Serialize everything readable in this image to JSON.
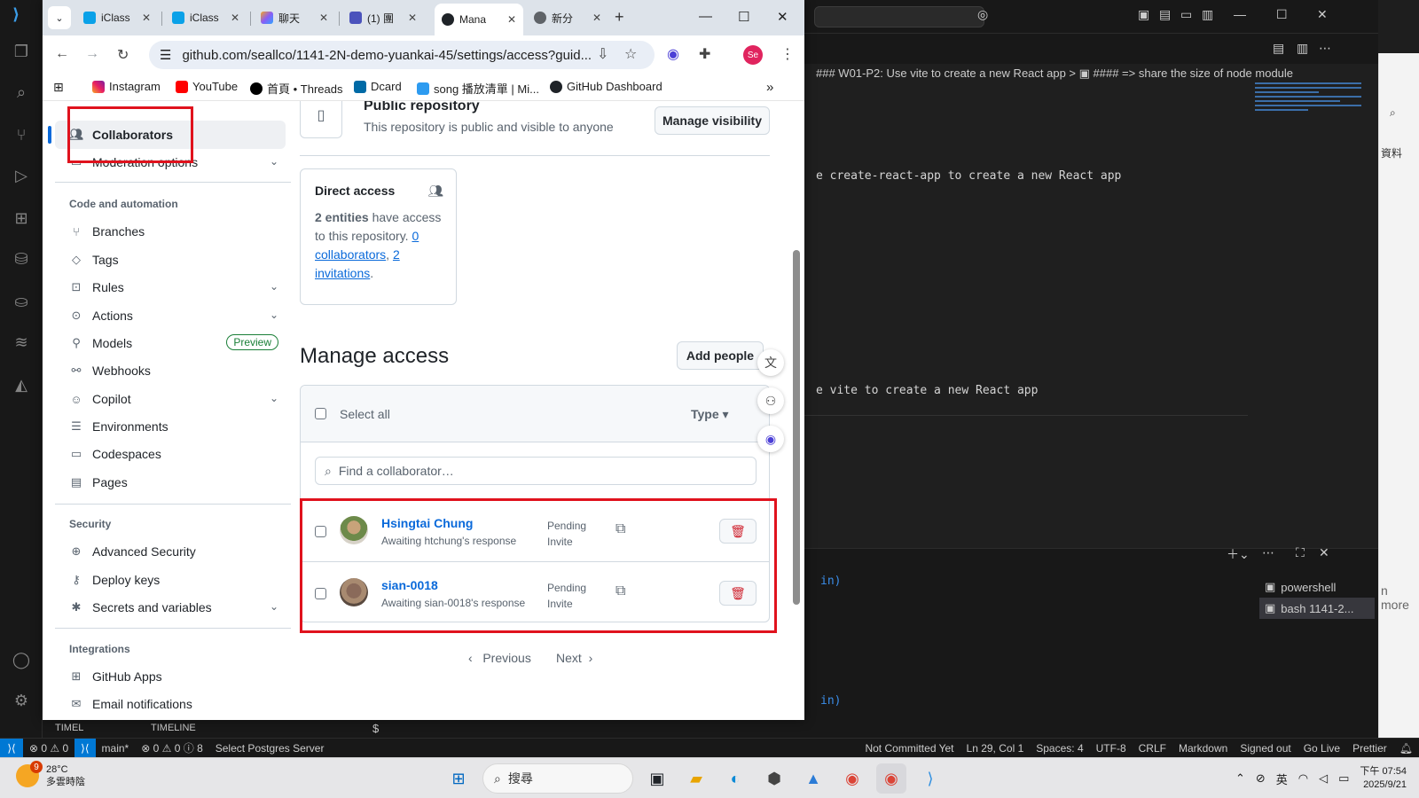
{
  "chrome": {
    "tabs": [
      {
        "label": "iClass",
        "favicon_color": "#0aa1e8"
      },
      {
        "label": "iClass",
        "favicon_color": "#0aa1e8"
      },
      {
        "label": "聊天",
        "favicon_color": "#8a5cf6"
      },
      {
        "label": "(1) 團",
        "favicon_color": "#4b53bc"
      },
      {
        "label": "Mana",
        "favicon_color": "#1f2328"
      },
      {
        "label": "新分",
        "favicon_color": "#5f6368"
      }
    ],
    "url": "github.com/seallco/1141-2N-demo-yuankai-45/settings/access?guid...",
    "profile_initials": "Se",
    "bookmarks": [
      "Instagram",
      "YouTube",
      "首頁 • Threads",
      "Dcard",
      "song 播放清單 | Mi...",
      "GitHub Dashboard"
    ]
  },
  "sidebar": {
    "items_access": [
      {
        "label": "Collaborators",
        "icon": "people-icon",
        "selected": true
      },
      {
        "label": "Moderation options",
        "icon": "comment-icon",
        "expandable": true
      }
    ],
    "section_code": "Code and automation",
    "items_code": [
      {
        "label": "Branches",
        "icon": "branch-icon"
      },
      {
        "label": "Tags",
        "icon": "tag-icon"
      },
      {
        "label": "Rules",
        "icon": "rules-icon",
        "expandable": true
      },
      {
        "label": "Actions",
        "icon": "play-icon",
        "expandable": true
      },
      {
        "label": "Models",
        "icon": "models-icon",
        "badge": "Preview"
      },
      {
        "label": "Webhooks",
        "icon": "webhook-icon"
      },
      {
        "label": "Copilot",
        "icon": "copilot-icon",
        "expandable": true
      },
      {
        "label": "Environments",
        "icon": "server-icon"
      },
      {
        "label": "Codespaces",
        "icon": "codespaces-icon"
      },
      {
        "label": "Pages",
        "icon": "browser-icon"
      }
    ],
    "section_security": "Security",
    "items_security": [
      {
        "label": "Advanced Security",
        "icon": "shield-icon"
      },
      {
        "label": "Deploy keys",
        "icon": "key-icon"
      },
      {
        "label": "Secrets and variables",
        "icon": "asterisk-icon",
        "expandable": true
      }
    ],
    "section_integrations": "Integrations",
    "items_integrations": [
      {
        "label": "GitHub Apps",
        "icon": "apps-icon"
      },
      {
        "label": "Email notifications",
        "icon": "mail-icon"
      }
    ]
  },
  "main": {
    "public_repo_title": "Public repository",
    "public_repo_desc": "This repository is public and visible to anyone",
    "manage_visibility": "Manage visibility",
    "direct_access_title": "Direct access",
    "direct_access_count": "2 entities",
    "direct_access_text1": " have access to this repository. ",
    "collab_link": "0 collaborators",
    "invite_link": "2 invitations",
    "manage_access_title": "Manage access",
    "add_people": "Add people",
    "select_all": "Select all",
    "type_filter": "Type",
    "find_placeholder": "Find a collaborator…",
    "rows": [
      {
        "name": "Hsingtai Chung",
        "sub": "Awaiting htchung's response",
        "status1": "Pending",
        "status2": "Invite"
      },
      {
        "name": "sian-0018",
        "sub": "Awaiting sian-0018's response",
        "status1": "Pending",
        "status2": "Invite"
      }
    ],
    "prev": "Previous",
    "next": "Next"
  },
  "vscode": {
    "breadcrumb": "### W01-P2: Use vite to create a new React app > ▣ #### => share the size of node module",
    "code_line1": "e create-react-app to create a new React app",
    "code_line2": "e vite to create a new React app",
    "terminals": [
      "powershell",
      "bash  1141-2..."
    ],
    "term_frag1": "in)",
    "term_frag2": "in)",
    "timeline1": "TIMEL",
    "timeline2": "TIMELINE",
    "prompt": "$",
    "more_text": "n more",
    "right_text": "資料",
    "status": {
      "errors": "⊗ 0 ⚠ 0",
      "branch": "main*",
      "problems": "⊗ 0 ⚠ 0 ⓘ 8",
      "postgres": "Select Postgres Server",
      "commit": "Not Committed Yet",
      "position": "Ln 29, Col 1",
      "spaces": "Spaces: 4",
      "encoding": "UTF-8",
      "eol": "CRLF",
      "lang": "Markdown",
      "signed": "Signed out",
      "golive": "Go Live",
      "prettier": "Prettier"
    }
  },
  "taskbar": {
    "weather_temp": "28°C",
    "weather_desc": "多雲時陰",
    "weather_badge": "9",
    "search_label": "搜尋",
    "ime": "英",
    "time": "下午 07:54",
    "date": "2025/9/21"
  }
}
